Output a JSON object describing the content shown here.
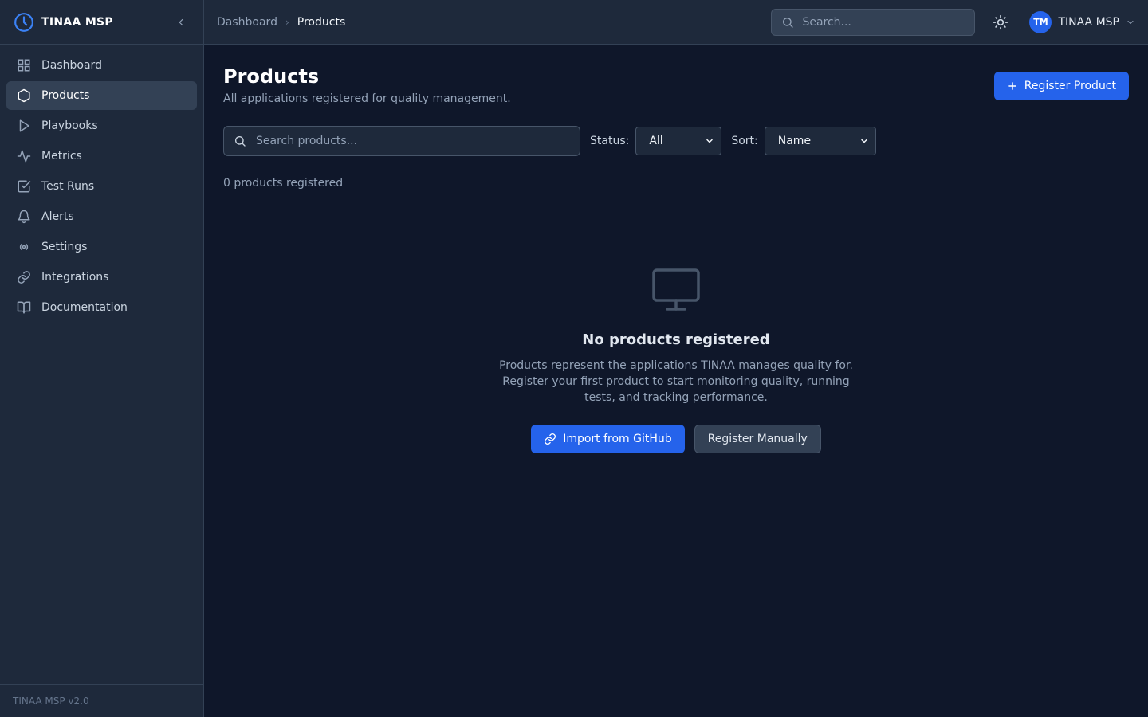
{
  "brand": {
    "name": "TINAA MSP",
    "version": "TINAA MSP v2.0",
    "accent": "#3b82f6"
  },
  "sidebar": {
    "items": [
      {
        "label": "Dashboard",
        "icon": "grid-icon"
      },
      {
        "label": "Products",
        "icon": "hexagon-icon",
        "active": true
      },
      {
        "label": "Playbooks",
        "icon": "play-icon"
      },
      {
        "label": "Metrics",
        "icon": "activity-icon"
      },
      {
        "label": "Test Runs",
        "icon": "check-square-icon"
      },
      {
        "label": "Alerts",
        "icon": "bell-icon"
      },
      {
        "label": "Settings",
        "icon": "radio-icon"
      },
      {
        "label": "Integrations",
        "icon": "link-icon"
      },
      {
        "label": "Documentation",
        "icon": "book-icon"
      }
    ]
  },
  "topbar": {
    "breadcrumb": [
      "Dashboard",
      "Products"
    ],
    "search_placeholder": "Search...",
    "user": {
      "initials": "TM",
      "name": "TINAA MSP"
    }
  },
  "main": {
    "title": "Products",
    "subtitle": "All applications registered for quality management.",
    "register_label": "Register Product",
    "search_placeholder": "Search products...",
    "status_label": "Status:",
    "status_value": "All",
    "sort_label": "Sort:",
    "sort_value": "Name",
    "count_text": "0 products registered"
  },
  "empty_state": {
    "icon": "monitor-icon",
    "title": "No products registered",
    "description": "Products represent the applications TINAA manages quality for. Register your first product to start monitoring quality, running tests, and tracking performance.",
    "import_label": "Import from GitHub",
    "manual_label": "Register Manually"
  },
  "colors": {
    "background": "#0f172a",
    "panel": "#1e293b",
    "border": "#334155",
    "primary": "#2563eb"
  }
}
